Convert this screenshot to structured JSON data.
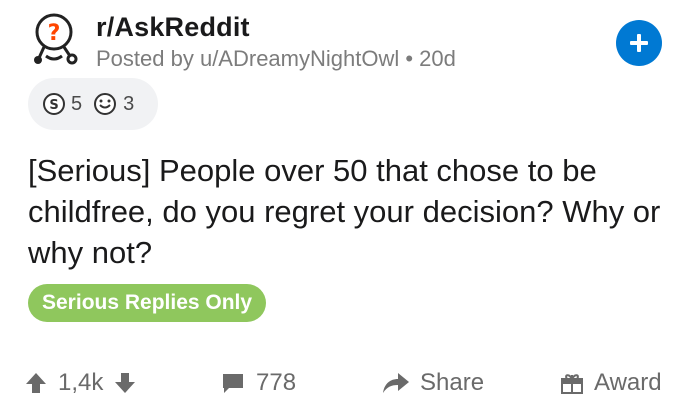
{
  "post": {
    "subreddit": "r/AskReddit",
    "posted_by": "Posted by u/ADreamyNightOwl • 20d",
    "title": "[Serious] People over 50 that chose to be childfree, do you regret your decision? Why or why not?",
    "flair": "Serious Replies Only"
  },
  "awards": {
    "items": [
      {
        "icon": "silver-award-icon",
        "count": "5"
      },
      {
        "icon": "helpful-award-icon",
        "count": "3"
      }
    ]
  },
  "actions": {
    "score": "1,4k",
    "comments": "778",
    "share": "Share",
    "award": "Award"
  },
  "colors": {
    "join_button": "#0079d3",
    "flair_bg": "#8fc75d",
    "meta_text": "#7c7c7c",
    "action_text": "#6a6a6a"
  }
}
